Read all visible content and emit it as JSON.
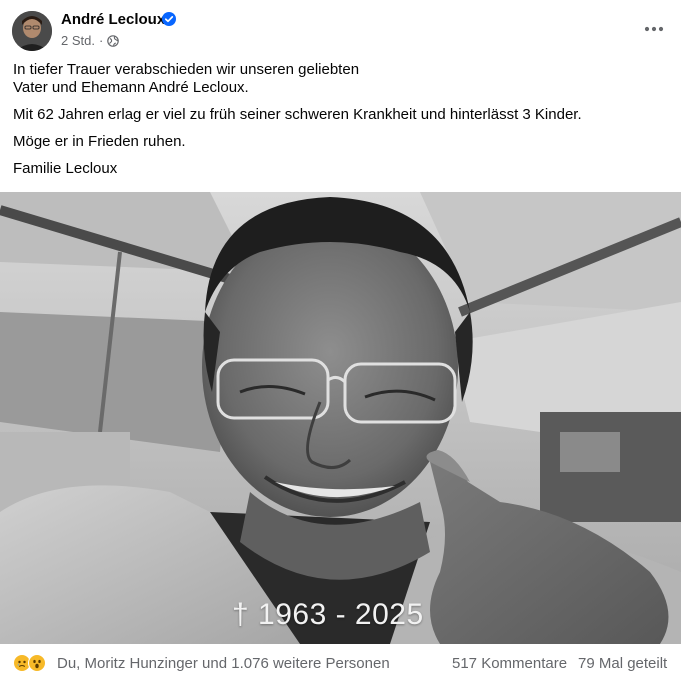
{
  "post": {
    "author_name": "André Lecloux",
    "verified": true,
    "timestamp": "2 Std.",
    "separator": "·",
    "privacy_icon": "globe-icon",
    "more_icon": "more-horizontal-icon",
    "paragraphs": [
      "In tiefer Trauer verabschieden wir unseren geliebten\nVater und Ehemann André Lecloux.",
      "Mit 62 Jahren erlag er viel zu früh seiner schweren Krankheit und hinterlässt 3 Kinder.",
      "Möge er in Frieden ruhen.",
      "Familie Lecloux"
    ],
    "photo": {
      "description_icon": "portrait-photo",
      "caption": "† 1963 - 2025"
    },
    "footer": {
      "reaction_icons": [
        "sad-reaction-icon",
        "wow-reaction-icon"
      ],
      "reaction_text": "Du, Moritz Hunzinger und 1.076 weitere Personen",
      "comments": "517 Kommentare",
      "shares": "79 Mal geteilt"
    }
  },
  "colors": {
    "secondary_text": "#65676b",
    "verified_blue": "#0866ff",
    "reaction_yellow": "#f7b928"
  }
}
